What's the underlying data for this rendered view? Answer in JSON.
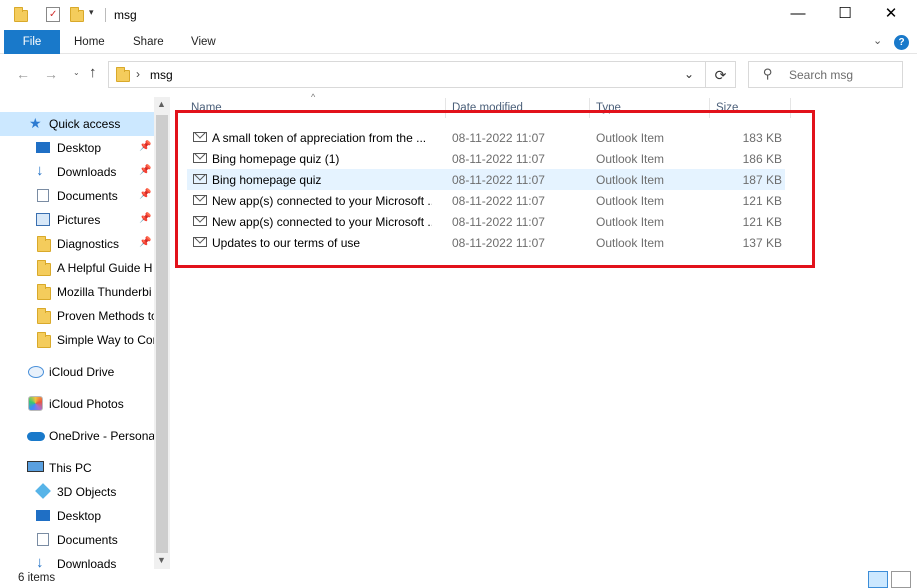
{
  "window": {
    "title": "msg",
    "controls": {
      "minimize": "—",
      "maximize": "☐",
      "close": "✕"
    }
  },
  "ribbon": {
    "tabs": [
      "File",
      "Home",
      "Share",
      "View"
    ]
  },
  "nav": {
    "address": {
      "path_sep": "›",
      "folder": "msg"
    },
    "search_placeholder": "Search msg"
  },
  "sidebar": {
    "items": [
      {
        "label": "Quick access",
        "icon": "star-icon",
        "pinned": false,
        "selected": true
      },
      {
        "label": "Desktop",
        "icon": "desktop-icon",
        "pinned": true
      },
      {
        "label": "Downloads",
        "icon": "downloads-icon",
        "pinned": true
      },
      {
        "label": "Documents",
        "icon": "documents-icon",
        "pinned": true
      },
      {
        "label": "Pictures",
        "icon": "pictures-icon",
        "pinned": true
      },
      {
        "label": "Diagnostics",
        "icon": "folder-icon",
        "pinned": true
      },
      {
        "label": "A Helpful Guide H",
        "icon": "folder-icon",
        "pinned": false
      },
      {
        "label": "Mozilla Thunderbi",
        "icon": "folder-icon",
        "pinned": false
      },
      {
        "label": "Proven Methods to",
        "icon": "folder-icon",
        "pinned": false
      },
      {
        "label": "Simple Way to Cor",
        "icon": "folder-icon",
        "pinned": false
      },
      {
        "label": "iCloud Drive",
        "icon": "icloud-icon",
        "pinned": false
      },
      {
        "label": "iCloud Photos",
        "icon": "icloud-photos-icon",
        "pinned": false
      },
      {
        "label": "OneDrive - Personal",
        "icon": "onedrive-icon",
        "pinned": false
      },
      {
        "label": "This PC",
        "icon": "pc-icon",
        "pinned": false
      },
      {
        "label": "3D Objects",
        "icon": "3d-objects-icon",
        "pinned": false
      },
      {
        "label": "Desktop",
        "icon": "desktop-icon",
        "pinned": false
      },
      {
        "label": "Documents",
        "icon": "documents-icon",
        "pinned": false
      },
      {
        "label": "Downloads",
        "icon": "downloads-icon",
        "pinned": false
      }
    ]
  },
  "columns": {
    "name": "Name",
    "date": "Date modified",
    "type": "Type",
    "size": "Size"
  },
  "files": [
    {
      "name": "A small token of appreciation from the ...",
      "date": "08-11-2022 11:07",
      "type": "Outlook Item",
      "size": "183 KB"
    },
    {
      "name": "Bing homepage quiz (1)",
      "date": "08-11-2022 11:07",
      "type": "Outlook Item",
      "size": "186 KB"
    },
    {
      "name": "Bing homepage quiz",
      "date": "08-11-2022 11:07",
      "type": "Outlook Item",
      "size": "187 KB",
      "selected": true
    },
    {
      "name": "New app(s) connected to your Microsoft ...",
      "date": "08-11-2022 11:07",
      "type": "Outlook Item",
      "size": "121 KB"
    },
    {
      "name": "New app(s) connected to your Microsoft ...",
      "date": "08-11-2022 11:07",
      "type": "Outlook Item",
      "size": "121 KB"
    },
    {
      "name": "Updates to our terms of use",
      "date": "08-11-2022 11:07",
      "type": "Outlook Item",
      "size": "137 KB"
    }
  ],
  "status": {
    "item_count": "6 items"
  },
  "colors": {
    "accent": "#1979ca",
    "highlight_border": "#e2121b",
    "selected_row": "#e5f3ff",
    "quick_access_bg": "#cce8ff"
  }
}
